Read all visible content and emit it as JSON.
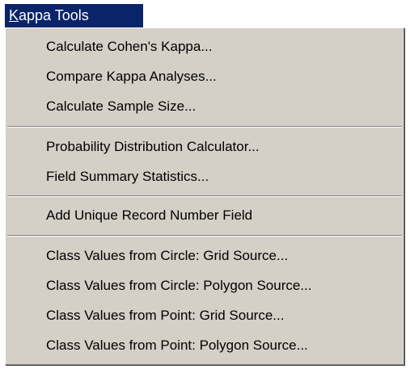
{
  "menu": {
    "title_accel": "K",
    "title_rest": "appa Tools",
    "groups": [
      [
        "Calculate Cohen's Kappa...",
        "Compare Kappa Analyses...",
        "Calculate Sample Size..."
      ],
      [
        "Probability Distribution Calculator...",
        "Field Summary Statistics..."
      ],
      [
        "Add Unique Record Number Field"
      ],
      [
        "Class Values from Circle: Grid Source...",
        "Class Values from Circle: Polygon Source...",
        "Class Values from Point: Grid Source...",
        "Class Values from Point: Polygon Source..."
      ]
    ]
  },
  "colors": {
    "menu_highlight": "#0a246a",
    "menu_background": "#d4d0c8",
    "text": "#000000"
  }
}
